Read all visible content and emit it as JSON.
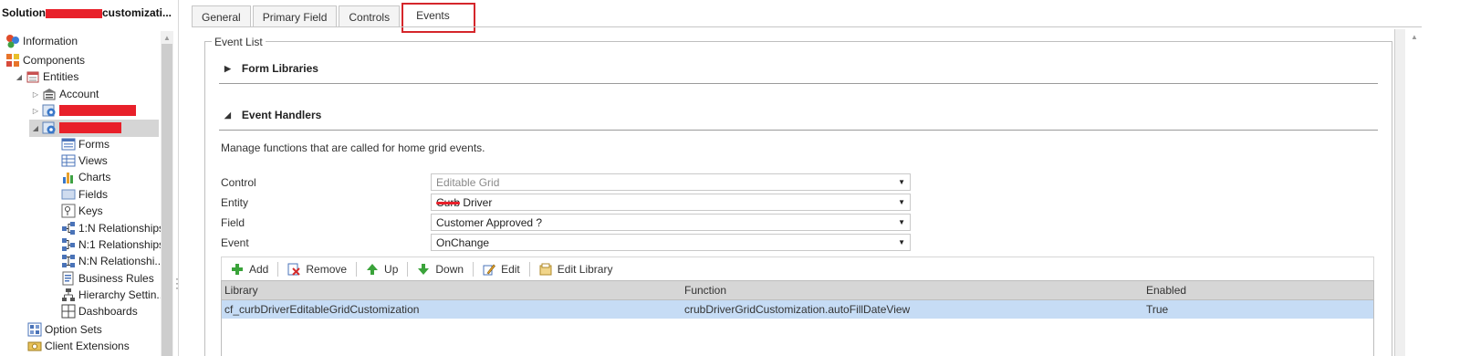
{
  "solution": {
    "title_prefix": "Solution",
    "title_suffix": "customizati..."
  },
  "tree": {
    "information": "Information",
    "components": "Components",
    "entities": "Entities",
    "account": "Account",
    "forms": "Forms",
    "views": "Views",
    "charts": "Charts",
    "fields": "Fields",
    "keys": "Keys",
    "rel_1n": "1:N Relationships",
    "rel_n1": "N:1 Relationships",
    "rel_nn": "N:N Relationshi...",
    "business_rules": "Business Rules",
    "hierarchy": "Hierarchy Settin...",
    "dashboards": "Dashboards",
    "option_sets": "Option Sets",
    "client_extensions": "Client Extensions"
  },
  "tabs": [
    "General",
    "Primary Field",
    "Controls",
    "Events"
  ],
  "event_list": {
    "legend": "Event List",
    "form_libraries": "Form Libraries",
    "event_handlers": "Event Handlers",
    "description": "Manage functions that are called for home grid events."
  },
  "fields": {
    "control_label": "Control",
    "control_value": "Editable Grid",
    "entity_label": "Entity",
    "entity_value": "Curb Driver",
    "field_label": "Field",
    "field_value": "Customer Approved ?",
    "event_label": "Event",
    "event_value": "OnChange"
  },
  "toolbar": {
    "add": "Add",
    "remove": "Remove",
    "up": "Up",
    "down": "Down",
    "edit": "Edit",
    "edit_library": "Edit Library"
  },
  "grid": {
    "headers": {
      "library": "Library",
      "function": "Function",
      "enabled": "Enabled"
    },
    "rows": [
      {
        "library": "cf_curbDriverEditableGridCustomization",
        "function": "crubDriverGridCustomization.autoFillDateView",
        "enabled": "True"
      }
    ]
  },
  "colors": {
    "highlight": "#d5262b",
    "selected_row": "#c6dcf5",
    "redaction": "#e8202a"
  }
}
